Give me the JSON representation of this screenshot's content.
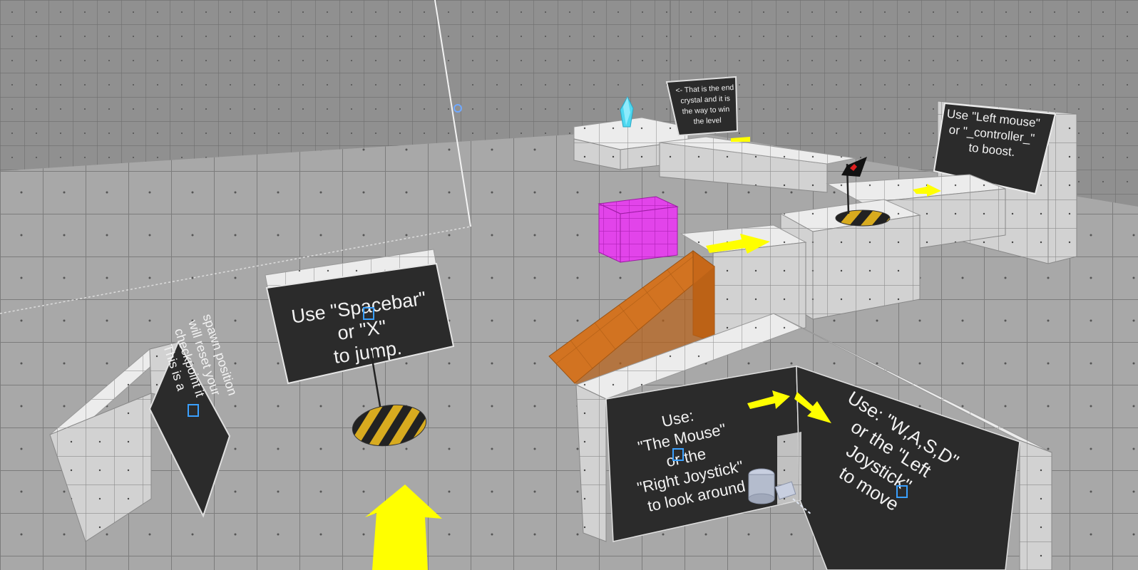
{
  "scene": {
    "signs": {
      "jump": {
        "lines": [
          "Use \"Spacebar\"",
          "or \"X\"",
          "to jump."
        ]
      },
      "checkpoint": {
        "lines": [
          "This is a",
          "checkpoint it",
          "will reset your",
          "spawn position"
        ]
      },
      "look": {
        "lines": [
          "Use:",
          "\"The Mouse\"",
          "or the",
          "\"Right Joystick\"",
          "to look around"
        ]
      },
      "move": {
        "lines": [
          "Use: \"W,A,S,D\"",
          "or the \"Left",
          "Joystick\"",
          "to move"
        ]
      },
      "boost": {
        "lines": [
          "Use \"Left mouse\"",
          "or \"_controller_\"",
          "to boost."
        ]
      },
      "crystal": {
        "lines": [
          "<- That is the end",
          "crystal and it is",
          "the way to win",
          "the level"
        ]
      }
    },
    "colors": {
      "floor": "#a6a6a6",
      "wall": "#8f8f8f",
      "block_top": "#ededed",
      "block_side": "#d4d4d4",
      "sign_board": "#2b2b2b",
      "arrow": "#ffff00",
      "ramp": "#d4731c",
      "cube": "#e040e8",
      "crystal": "#4fd8f0",
      "flag": "#111111",
      "flag_mark": "#e02020",
      "hazard_yellow": "#e0b020",
      "hazard_dark": "#222222"
    },
    "icons": [
      "player-marker-icon",
      "checkpoint-flag-icon",
      "end-crystal-icon",
      "camera-gizmo-icon"
    ]
  }
}
